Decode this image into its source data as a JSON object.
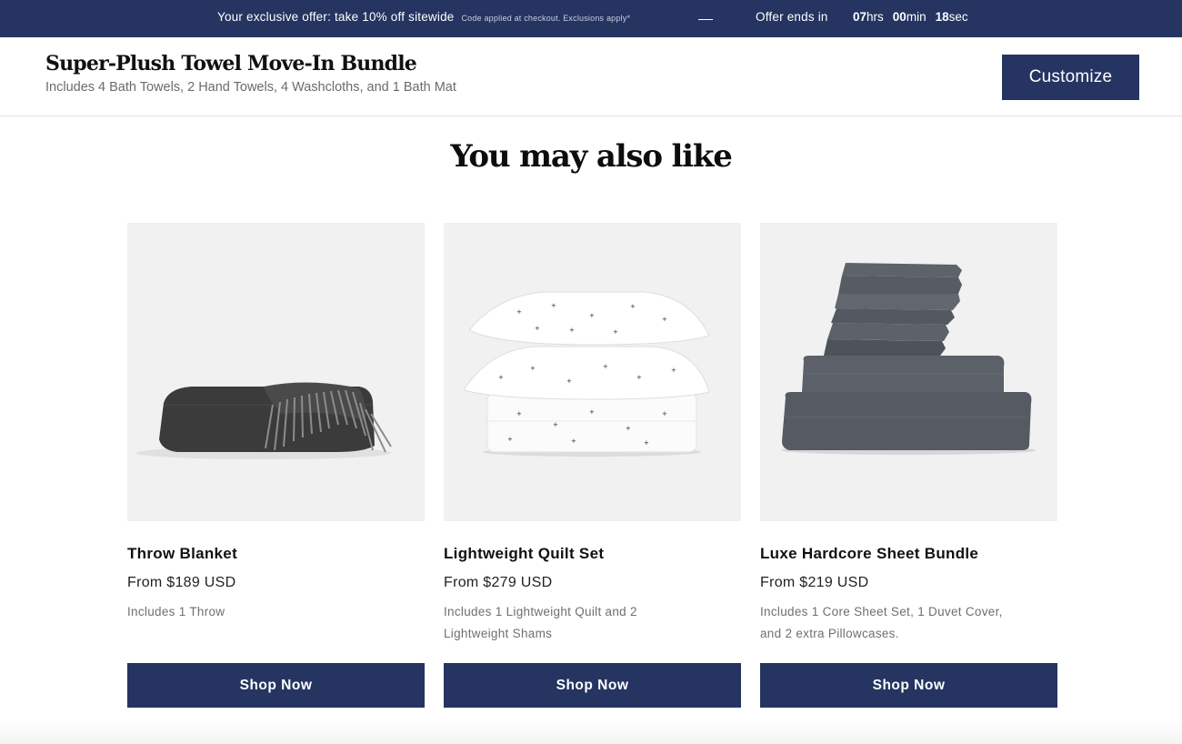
{
  "promo": {
    "offer_text": "Your exclusive offer: take 10% off sitewide",
    "fine_print": "Code applied at checkout. Exclusions apply*",
    "ends_label": "Offer ends in",
    "hours": "07",
    "hours_unit": "hrs",
    "minutes": "00",
    "minutes_unit": "min",
    "seconds": "18",
    "seconds_unit": "sec"
  },
  "product_header": {
    "title": "Super-Plush Towel Move-In Bundle",
    "subtitle": "Includes 4 Bath Towels, 2 Hand Towels, 4 Washcloths, and 1 Bath Mat",
    "customize_label": "Customize"
  },
  "recommendations": {
    "heading": "You may also like",
    "items": [
      {
        "name": "Throw Blanket",
        "price": "From $189 USD",
        "description": "Includes 1 Throw",
        "button_label": "Shop Now",
        "image_icon": "throw-blanket-image"
      },
      {
        "name": "Lightweight Quilt Set",
        "price": "From $279 USD",
        "description": "Includes 1 Lightweight Quilt and 2 Lightweight Shams",
        "button_label": "Shop Now",
        "image_icon": "quilt-set-image"
      },
      {
        "name": "Luxe Hardcore Sheet Bundle",
        "price": "From $219 USD",
        "description": "Includes 1 Core Sheet Set, 1 Duvet Cover, and 2 extra Pillowcases.",
        "button_label": "Shop Now",
        "image_icon": "sheet-bundle-image"
      }
    ]
  },
  "colors": {
    "brand_navy": "#253461",
    "card_background": "#f1f1f1"
  }
}
